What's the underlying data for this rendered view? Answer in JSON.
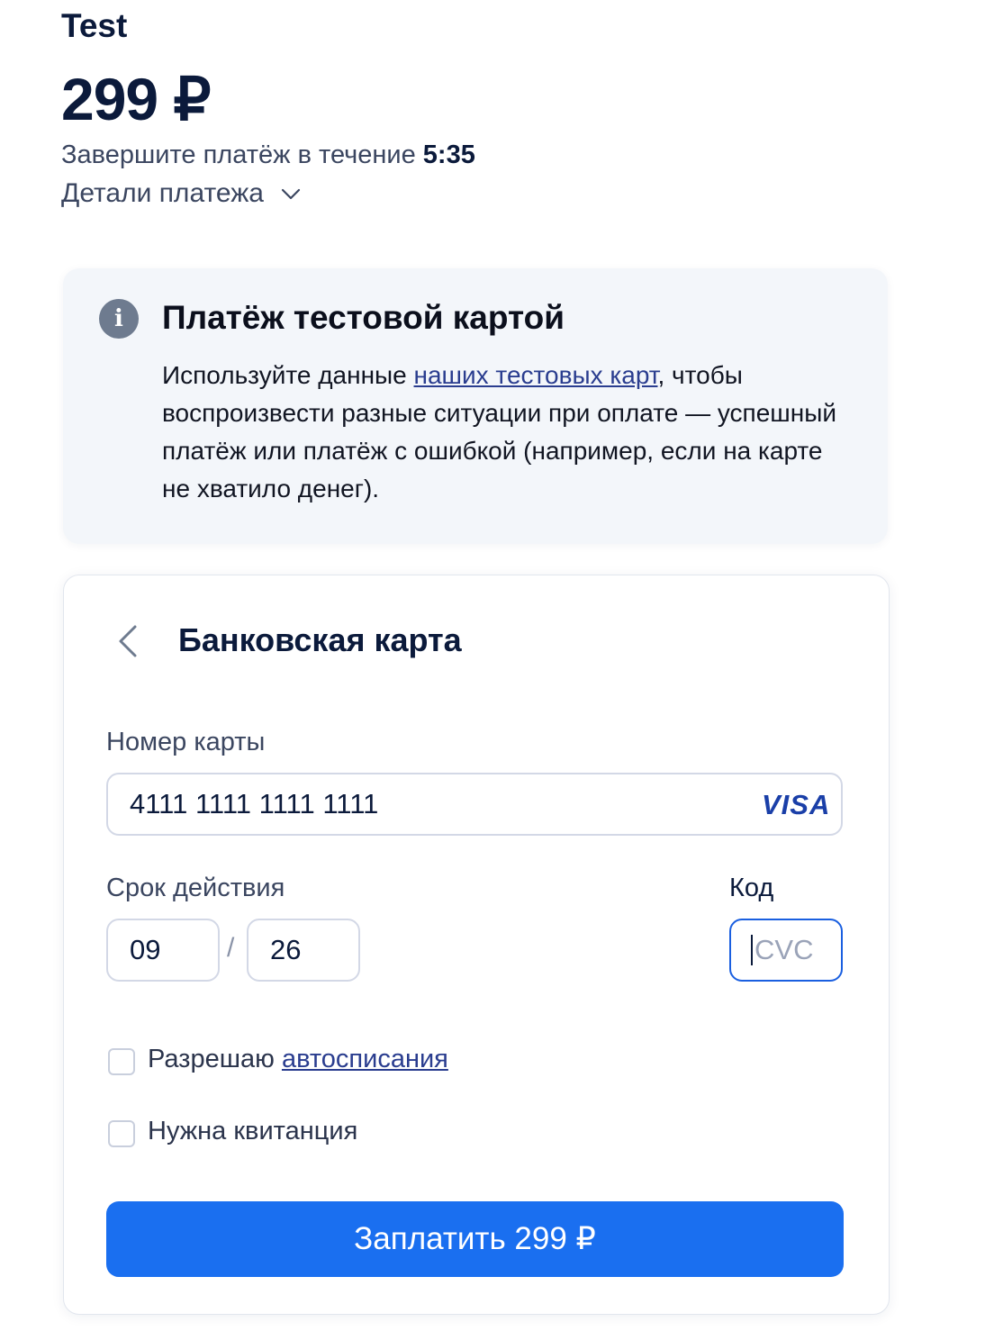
{
  "header": {
    "merchant": "Test",
    "amount": "299 ₽",
    "timer_prefix": "Завершите платёж в течение ",
    "timer_value": "5:35",
    "details_label": "Детали платежа"
  },
  "notice": {
    "icon": "info-icon",
    "title": "Платёж тестовой картой",
    "text_before": "Используйте данные ",
    "link": "наших тестовых карт",
    "text_after": ", чтобы воспроизвести разные ситуации при оплате — успешный платёж или платёж с ошибкой (например, если на карте не хватило денег)."
  },
  "card_form": {
    "title": "Банковская карта",
    "card_number_label": "Номер карты",
    "card_number_value": "4111 1111 1111 1111",
    "brand": "VISA",
    "expiry_label": "Срок действия",
    "expiry_month": "09",
    "expiry_separator": "/",
    "expiry_year": "26",
    "code_label": "Код",
    "cvc_placeholder": "CVC",
    "autopay_label": "Разрешаю ",
    "autopay_link": "автосписания",
    "autopay_checked": false,
    "receipt_label": "Нужна квитанция",
    "receipt_checked": false,
    "pay_button": "Заплатить 299 ₽"
  },
  "colors": {
    "primary": "#1a6ff0",
    "text_dark": "#0b1a3b",
    "notice_bg": "#f3f6fa",
    "visa": "#1a3fa8",
    "focus_border": "#1a5fe0"
  }
}
